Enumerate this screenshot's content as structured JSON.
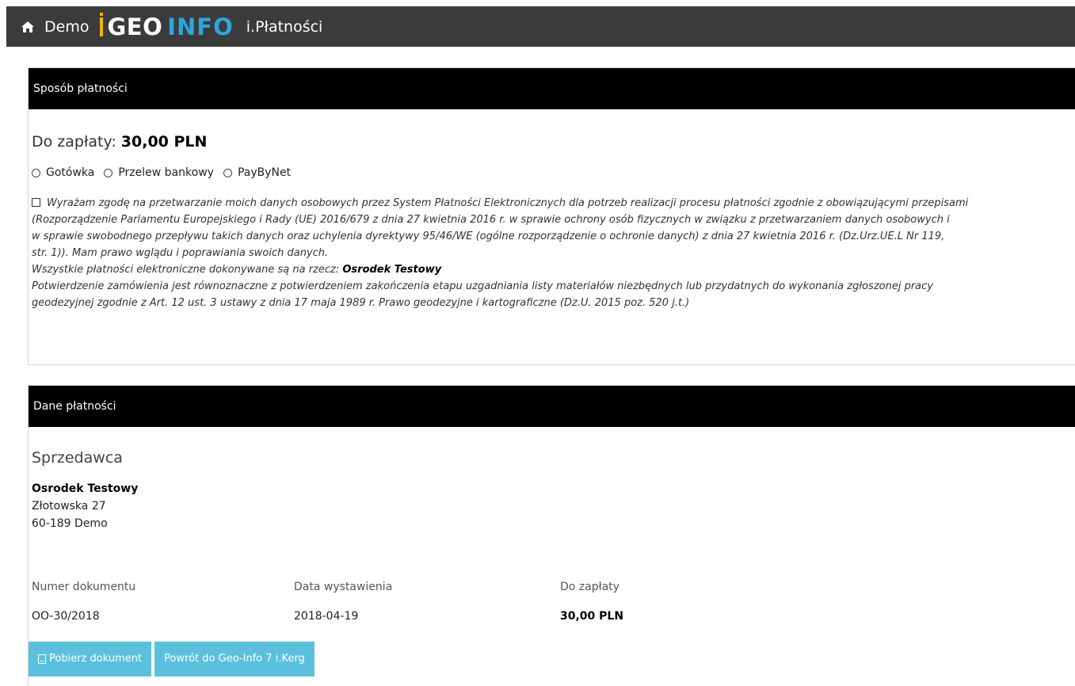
{
  "header": {
    "home_icon": "home-icon",
    "demo_label": "Demo",
    "logo_geo": "GEO",
    "logo_info": "INFO",
    "app_name": "i.Płatności",
    "colors": {
      "bar": "#3b3b3b",
      "logo_info": "#2aa6e0",
      "logo_accent": "#f4b400"
    }
  },
  "payment_method": {
    "title": "Sposób płatności",
    "amount_prefix": "Do zapłaty: ",
    "amount_value": "30,00 PLN",
    "options": [
      "Gotówka",
      "Przelew bankowy",
      "PayByNet"
    ],
    "consent_lines": [
      "Wyrażam zgodę na przetwarzanie moich danych osobowych przez System Płatności Elektronicznych dla potrzeb realizacji procesu płatności zgodnie z obowiązującymi przepisami",
      "(Rozporządzenie Parlamentu Europejskiego i Rady (UE) 2016/679 z dnia 27 kwietnia 2016 r. w sprawie ochrony osób fizycznych w związku z przetwarzaniem danych osobowych i",
      "w sprawie swobodnego przepływu takich danych oraz uchylenia dyrektywy 95/46/WE (ogólne rozporządzenie o ochronie danych) z dnia 27 kwietnia 2016 r. (Dz.Urz.UE.L Nr 119,",
      "str. 1)). Mam prawo wglądu i poprawiania swoich danych."
    ],
    "beneficiary_prefix": "Wszystkie płatności elektroniczne dokonywane są na rzecz: ",
    "beneficiary_name": "Osrodek Testowy",
    "confirmation_lines": [
      "Potwierdzenie zamówienia jest równoznaczne z potwierdzeniem zakończenia etapu uzgadniania listy materiałów niezbędnych lub przydatnych do wykonania zgłoszonej pracy",
      "geodezyjnej zgodnie z Art. 12 ust. 3 ustawy z dnia 17 maja 1989 r. Prawo geodezyjne i kartograficzne (Dz.U. 2015 poz. 520 j.t.)"
    ]
  },
  "payment_data": {
    "title": "Dane płatności",
    "seller_title": "Sprzedawca",
    "seller_name": "Osrodek Testowy",
    "seller_street": "Złotowska 27",
    "seller_city": "60-189 Demo",
    "document_number_label": "Numer dokumentu",
    "document_number": "OO-30/2018",
    "issue_date_label": "Data wystawienia",
    "issue_date": "2018-04-19",
    "amount_label": "Do zapłaty",
    "amount": "30,00 PLN",
    "buttons": {
      "download": "Pobierz dokument",
      "back": "Powrót do Geo-Info 7 i.Kerg"
    },
    "button_color": "#5bc0de"
  }
}
